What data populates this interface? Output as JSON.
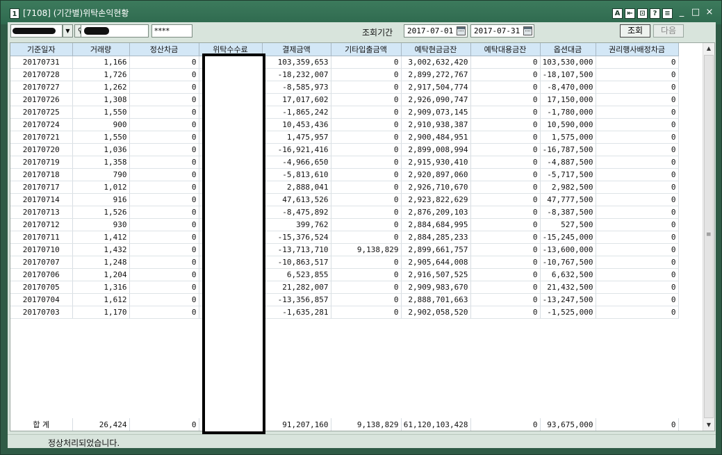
{
  "window": {
    "number_badge": "1",
    "title": "[7108] (기간별)위탁손익현황",
    "tools": [
      "A",
      "⇤",
      "⊡",
      "?",
      "≡"
    ],
    "controls": [
      "_",
      "□",
      "×"
    ]
  },
  "toolbar": {
    "password_mask": "****",
    "period_label": "조회기간",
    "date_from": "2017-07-01",
    "date_to": "2017-07-31",
    "query_label": "조회",
    "next_label": "다음"
  },
  "table": {
    "columns": [
      "기준일자",
      "거래량",
      "정산차금",
      "위탁수수료",
      "결제금액",
      "기타입출금액",
      "예탁현금금잔",
      "예탁대용금잔",
      "옵션대금",
      "권리행사배정차금"
    ],
    "rows": [
      [
        "20170731",
        "1,166",
        "0",
        "",
        "103,359,653",
        "0",
        "3,002,632,420",
        "0",
        "103,530,000",
        "0"
      ],
      [
        "20170728",
        "1,726",
        "0",
        "",
        "-18,232,007",
        "0",
        "2,899,272,767",
        "0",
        "-18,107,500",
        "0"
      ],
      [
        "20170727",
        "1,262",
        "0",
        "",
        "-8,585,973",
        "0",
        "2,917,504,774",
        "0",
        "-8,470,000",
        "0"
      ],
      [
        "20170726",
        "1,308",
        "0",
        "",
        "17,017,602",
        "0",
        "2,926,090,747",
        "0",
        "17,150,000",
        "0"
      ],
      [
        "20170725",
        "1,550",
        "0",
        "",
        "-1,865,242",
        "0",
        "2,909,073,145",
        "0",
        "-1,780,000",
        "0"
      ],
      [
        "20170724",
        "900",
        "0",
        "",
        "10,453,436",
        "0",
        "2,910,938,387",
        "0",
        "10,590,000",
        "0"
      ],
      [
        "20170721",
        "1,550",
        "0",
        "",
        "1,475,957",
        "0",
        "2,900,484,951",
        "0",
        "1,575,000",
        "0"
      ],
      [
        "20170720",
        "1,036",
        "0",
        "",
        "-16,921,416",
        "0",
        "2,899,008,994",
        "0",
        "-16,787,500",
        "0"
      ],
      [
        "20170719",
        "1,358",
        "0",
        "",
        "-4,966,650",
        "0",
        "2,915,930,410",
        "0",
        "-4,887,500",
        "0"
      ],
      [
        "20170718",
        "790",
        "0",
        "",
        "-5,813,610",
        "0",
        "2,920,897,060",
        "0",
        "-5,717,500",
        "0"
      ],
      [
        "20170717",
        "1,012",
        "0",
        "",
        "2,888,041",
        "0",
        "2,926,710,670",
        "0",
        "2,982,500",
        "0"
      ],
      [
        "20170714",
        "916",
        "0",
        "",
        "47,613,526",
        "0",
        "2,923,822,629",
        "0",
        "47,777,500",
        "0"
      ],
      [
        "20170713",
        "1,526",
        "0",
        "",
        "-8,475,892",
        "0",
        "2,876,209,103",
        "0",
        "-8,387,500",
        "0"
      ],
      [
        "20170712",
        "930",
        "0",
        "",
        "399,762",
        "0",
        "2,884,684,995",
        "0",
        "527,500",
        "0"
      ],
      [
        "20170711",
        "1,412",
        "0",
        "",
        "-15,376,524",
        "0",
        "2,884,285,233",
        "0",
        "-15,245,000",
        "0"
      ],
      [
        "20170710",
        "1,432",
        "0",
        "",
        "-13,713,710",
        "9,138,829",
        "2,899,661,757",
        "0",
        "-13,600,000",
        "0"
      ],
      [
        "20170707",
        "1,248",
        "0",
        "",
        "-10,863,517",
        "0",
        "2,905,644,008",
        "0",
        "-10,767,500",
        "0"
      ],
      [
        "20170706",
        "1,204",
        "0",
        "",
        "6,523,855",
        "0",
        "2,916,507,525",
        "0",
        "6,632,500",
        "0"
      ],
      [
        "20170705",
        "1,316",
        "0",
        "",
        "21,282,007",
        "0",
        "2,909,983,670",
        "0",
        "21,432,500",
        "0"
      ],
      [
        "20170704",
        "1,612",
        "0",
        "",
        "-13,356,857",
        "0",
        "2,888,701,663",
        "0",
        "-13,247,500",
        "0"
      ],
      [
        "20170703",
        "1,170",
        "0",
        "",
        "-1,635,281",
        "0",
        "2,902,058,520",
        "0",
        "-1,525,000",
        "0"
      ]
    ],
    "total": [
      "합 계",
      "26,424",
      "0",
      "",
      "91,207,160",
      "9,138,829",
      "61,120,103,428",
      "0",
      "93,675,000",
      "0"
    ]
  },
  "status": {
    "message": "정상처리되었습니다."
  }
}
